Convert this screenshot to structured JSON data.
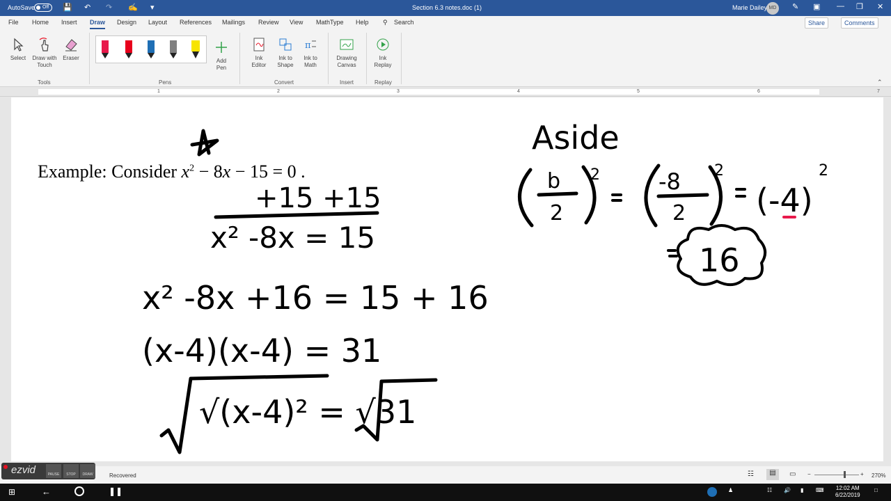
{
  "titlebar": {
    "autosave_label": "AutoSave",
    "autosave_state": "Off",
    "doc_title": "Section 6.3 notes.doc (1)",
    "user_name": "Marie Dailey",
    "user_initials": "MD"
  },
  "tabs": [
    {
      "label": "File"
    },
    {
      "label": "Home"
    },
    {
      "label": "Insert"
    },
    {
      "label": "Draw"
    },
    {
      "label": "Design"
    },
    {
      "label": "Layout"
    },
    {
      "label": "References"
    },
    {
      "label": "Mailings"
    },
    {
      "label": "Review"
    },
    {
      "label": "View"
    },
    {
      "label": "MathType"
    },
    {
      "label": "Help"
    }
  ],
  "search_label": "Search",
  "share_label": "Share",
  "comments_label": "Comments",
  "ribbon": {
    "select": "Select",
    "draw_touch_1": "Draw with",
    "draw_touch_2": "Touch",
    "eraser": "Eraser",
    "tools_group": "Tools",
    "pens_group": "Pens",
    "add_pen_1": "Add",
    "add_pen_2": "Pen",
    "ink_editor_1": "Ink",
    "ink_editor_2": "Editor",
    "ink_shape_1": "Ink to",
    "ink_shape_2": "Shape",
    "ink_math_1": "Ink to",
    "ink_math_2": "Math",
    "convert_group": "Convert",
    "canvas_1": "Drawing",
    "canvas_2": "Canvas",
    "insert_group": "Insert",
    "replay_1": "Ink",
    "replay_2": "Replay",
    "replay_group": "Replay",
    "pen_colors": [
      "#e8194b",
      "#e8001c",
      "#1f6fb5",
      "#808080",
      "#f7e400"
    ]
  },
  "ruler": [
    "1",
    "2",
    "3",
    "4",
    "5",
    "6",
    "7"
  ],
  "document": {
    "example_label": "Example:  Consider ",
    "eq_var": "x",
    "eq_exp": "2",
    "eq_rest": " − 8",
    "eq_var2": "x",
    "eq_rest2": " − 15 = 0 ."
  },
  "ink": {
    "aside": "Aside",
    "step1": "+15 +15",
    "step2": "x² -8x = 15",
    "step3": "x² -8x +16 = 15 + 16",
    "step4": "(x-4)(x-4)  = 31",
    "step5": "√(x-4)² = √31",
    "aside_b": "b",
    "aside_2": "2",
    "aside_neg8": "-8",
    "aside_neg4": "(-4)",
    "aside_16": "16"
  },
  "status": {
    "recovered": "Recovered",
    "zoom": "270%"
  },
  "ezvid": {
    "logo": "ezvid",
    "pause": "PAUSE",
    "stop": "STOP",
    "draw": "DRAW"
  },
  "taskbar": {
    "time": "12:02 AM",
    "date": "6/22/2019"
  }
}
